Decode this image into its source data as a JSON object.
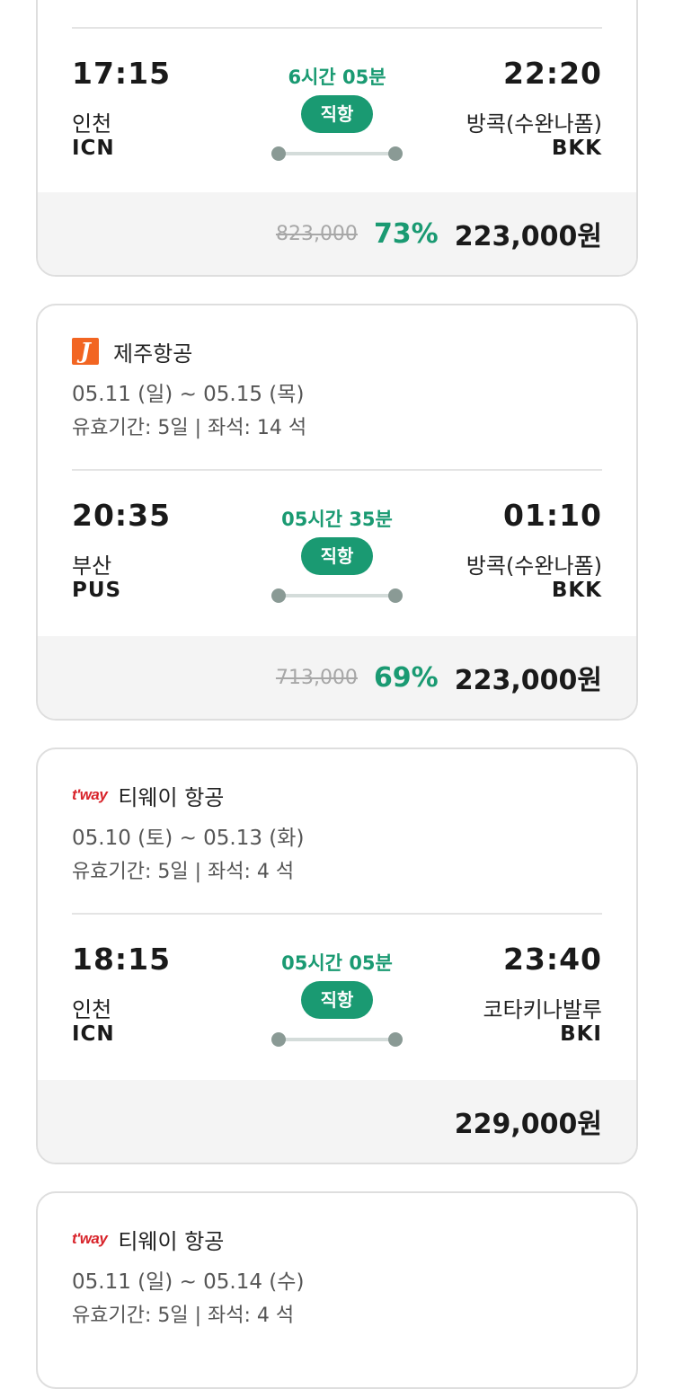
{
  "card1": {
    "flight": {
      "dep_time": "17:15",
      "dep_city": "인천",
      "dep_code": "ICN",
      "duration": "6시간 05분",
      "direct_label": "직항",
      "arr_time": "22:20",
      "arr_city": "방콕(수완나폼)",
      "arr_code": "BKK"
    },
    "price": {
      "original": "823,000",
      "discount": "73%",
      "final": "223,000원"
    }
  },
  "card2": {
    "airline": "제주항공",
    "airline_logo": "J",
    "dates": "05.11 (일) ~ 05.15 (목)",
    "meta": "유효기간: 5일 | 좌석: 14 석",
    "flight": {
      "dep_time": "20:35",
      "dep_city": "부산",
      "dep_code": "PUS",
      "duration": "05시간 35분",
      "direct_label": "직항",
      "arr_time": "01:10",
      "arr_city": "방콕(수완나폼)",
      "arr_code": "BKK"
    },
    "price": {
      "original": "713,000",
      "discount": "69%",
      "final": "223,000원"
    }
  },
  "card3": {
    "airline": "티웨이 항공",
    "airline_logo": "t'way",
    "dates": "05.10 (토) ~ 05.13 (화)",
    "meta": "유효기간: 5일 | 좌석: 4 석",
    "flight": {
      "dep_time": "18:15",
      "dep_city": "인천",
      "dep_code": "ICN",
      "duration": "05시간 05분",
      "direct_label": "직항",
      "arr_time": "23:40",
      "arr_city": "코타키나발루",
      "arr_code": "BKI"
    },
    "price": {
      "final": "229,000원"
    }
  },
  "card4": {
    "airline": "티웨이 항공",
    "airline_logo": "t'way",
    "dates": "05.11 (일) ~ 05.14 (수)",
    "meta": "유효기간: 5일 | 좌석: 4 석"
  },
  "colors": {
    "accent": "#1a9a72",
    "jeju_brand": "#f26522",
    "tway_brand": "#d8232a"
  }
}
